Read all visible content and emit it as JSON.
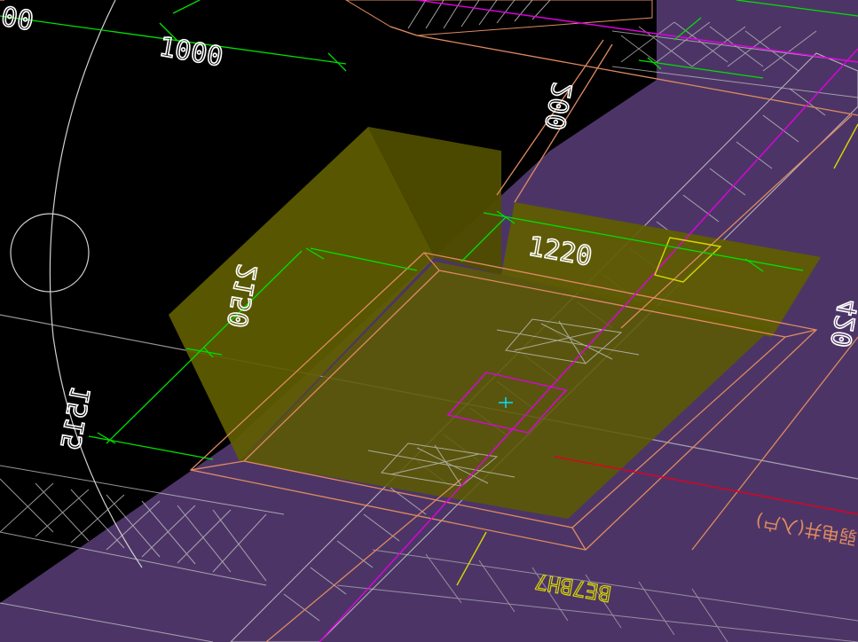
{
  "canvas": {
    "background_color": "#000000",
    "floor_slab_color": "#4c3566",
    "pit_fill_color": "#5c5a00",
    "pit_wall_color": "#5f5d00",
    "dimension_line_color": "#00e000",
    "outline_color": "#e08a60",
    "axis_line_color": "#e000e0",
    "hatch_color": "#c8c8c8",
    "annotation_yellow": "#d8d800",
    "section_line_red": "#e00020",
    "cursor_color": "#00e0ff"
  },
  "dimensions": {
    "d1000": "1000",
    "d1220": "1220",
    "d2150": "2150",
    "d1515": "1515",
    "d200": "200",
    "d420": "420",
    "d00": "00"
  },
  "labels": {
    "be_label": "BE7BH7",
    "chinese_note": "弱电井(入户)"
  }
}
